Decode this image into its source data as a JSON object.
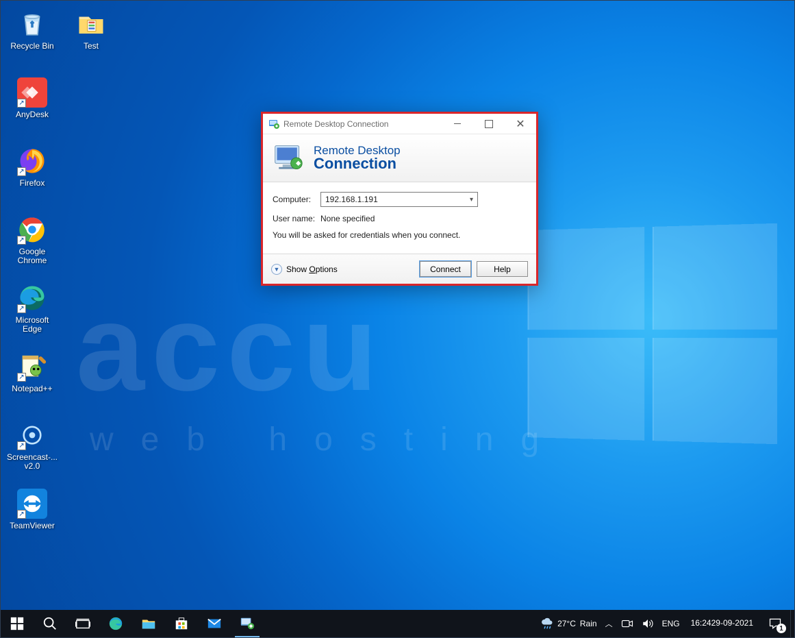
{
  "desktop_icons": {
    "recycle": "Recycle Bin",
    "test": "Test",
    "anydesk": "AnyDesk",
    "firefox": "Firefox",
    "chrome": "Google\nChrome",
    "edge": "Microsoft\nEdge",
    "npp": "Notepad++",
    "screencast": "Screencast-...\nv2.0",
    "teamviewer": "TeamViewer"
  },
  "watermark": {
    "top": "accu",
    "bottom": "web hosting"
  },
  "rdc": {
    "title": "Remote Desktop Connection",
    "banner1": "Remote Desktop",
    "banner2": "Connection",
    "computer_label": "Computer:",
    "computer_value": "192.168.1.191",
    "username_label": "User name:",
    "username_value": "None specified",
    "hint": "You will be asked for credentials when you connect.",
    "show_options": "Show Options",
    "connect": "Connect",
    "help": "Help"
  },
  "taskbar": {
    "weather_temp": "27°C",
    "weather_cond": "Rain",
    "lang": "ENG",
    "time": "16:24",
    "date": "29-09-2021",
    "notif_count": "1"
  }
}
